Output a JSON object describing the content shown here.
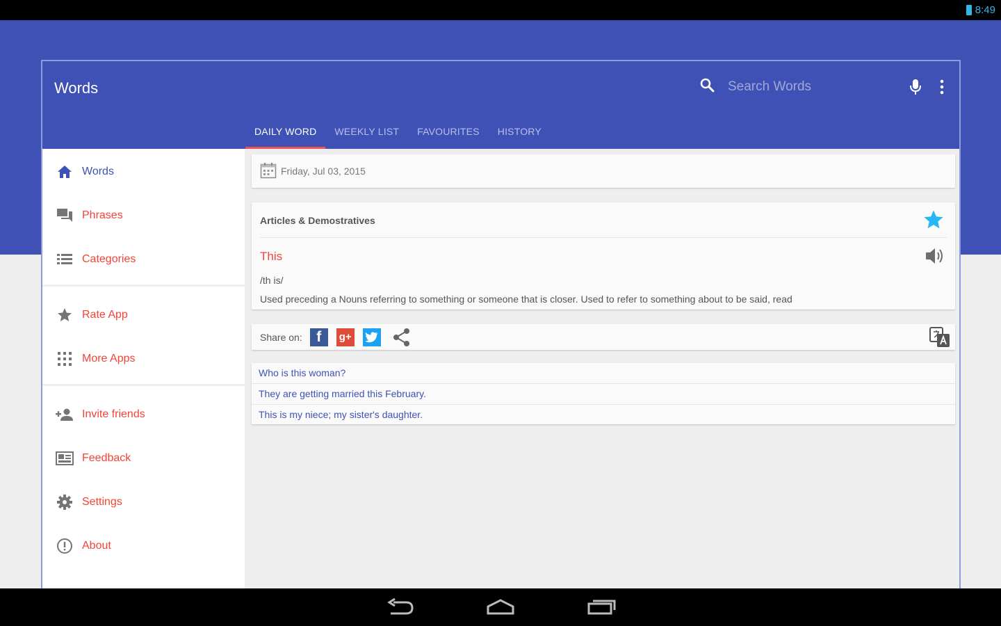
{
  "status": {
    "time": "8:49"
  },
  "app": {
    "title": "Words"
  },
  "search": {
    "placeholder": "Search Words"
  },
  "tabs": [
    {
      "label": "DAILY WORD"
    },
    {
      "label": "WEEKLY LIST"
    },
    {
      "label": "FAVOURITES"
    },
    {
      "label": "HISTORY"
    }
  ],
  "sidebar": {
    "items": [
      {
        "label": "Words",
        "icon": "home-icon"
      },
      {
        "label": "Phrases",
        "icon": "chat-icon"
      },
      {
        "label": "Categories",
        "icon": "list-icon"
      },
      {
        "label": "Rate App",
        "icon": "star-icon"
      },
      {
        "label": "More Apps",
        "icon": "apps-grid-icon"
      },
      {
        "label": "Invite friends",
        "icon": "add-person-icon"
      },
      {
        "label": "Feedback",
        "icon": "feedback-icon"
      },
      {
        "label": "Settings",
        "icon": "gear-icon"
      },
      {
        "label": "About",
        "icon": "info-icon"
      }
    ]
  },
  "daily": {
    "date": "Friday, Jul 03, 2015",
    "category": "Articles & Demostratives",
    "word": "This",
    "pronunciation": "/th is/",
    "definition": "Used preceding a Nouns referring to something or someone that is closer. Used to refer to something about to be said, read"
  },
  "share": {
    "label": "Share on:"
  },
  "examples": [
    "Who is this woman?",
    "They are getting married this February.",
    "This is my niece; my sister's daughter."
  ],
  "colors": {
    "primary": "#3f51b5",
    "accent": "#f44336",
    "star": "#29b6f6"
  }
}
